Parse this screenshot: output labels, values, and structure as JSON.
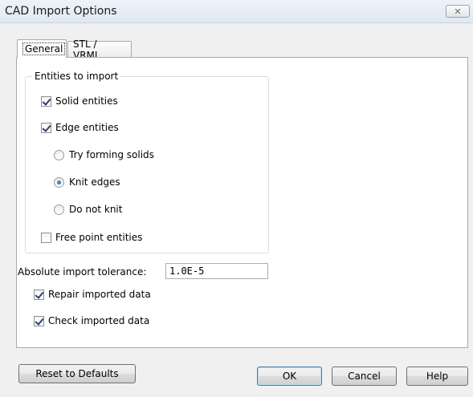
{
  "window": {
    "title": "CAD Import Options",
    "close_glyph": "✕"
  },
  "tabs": [
    {
      "label": "General",
      "active": true
    },
    {
      "label": "STL / VRML",
      "active": false
    }
  ],
  "entities": {
    "group_label": "Entities to import",
    "solid": {
      "label": "Solid entities",
      "checked": true
    },
    "edge": {
      "label": "Edge entities",
      "checked": true
    },
    "radios": [
      {
        "label": "Try forming solids",
        "selected": false
      },
      {
        "label": "Knit edges",
        "selected": true
      },
      {
        "label": "Do not knit",
        "selected": false
      }
    ],
    "free_point": {
      "label": "Free point entities",
      "checked": false
    }
  },
  "tolerance": {
    "label": "Absolute import tolerance:",
    "value": "1.0E-5"
  },
  "repair": {
    "label": "Repair imported data",
    "checked": true
  },
  "check": {
    "label": "Check imported data",
    "checked": true
  },
  "buttons": {
    "reset": "Reset to Defaults",
    "ok": "OK",
    "cancel": "Cancel",
    "help": "Help"
  }
}
